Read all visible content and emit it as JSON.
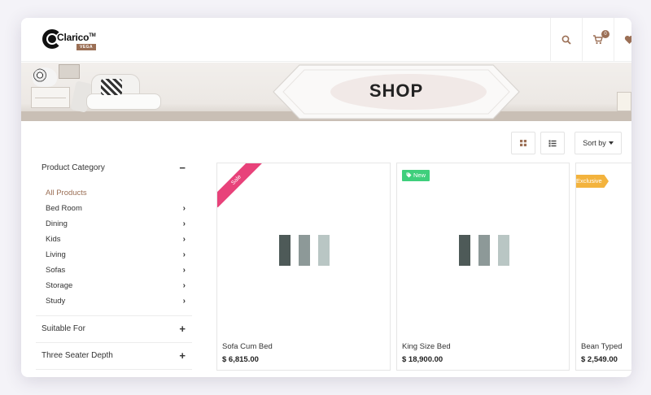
{
  "brand": {
    "name": "Clarico",
    "tm": "TM",
    "tag": "VEGA"
  },
  "header": {
    "icons": [
      "search-icon",
      "cart-icon",
      "heart-icon"
    ],
    "cart_count": "0"
  },
  "banner": {
    "title": "SHOP"
  },
  "toolbar": {
    "sort_label": "Sort by"
  },
  "sidebar": {
    "category_title": "Product Category",
    "categories": [
      "All Products",
      "Bed Room",
      "Dining",
      "Kids",
      "Living",
      "Sofas",
      "Storage",
      "Study"
    ],
    "filters": [
      "Suitable For",
      "Three Seater Depth"
    ]
  },
  "products": [
    {
      "name": "Sofa Cum Bed",
      "price": "$ 6,815.00",
      "badge": "Sale"
    },
    {
      "name": "King Size Bed",
      "price": "$ 18,900.00",
      "badge": "New"
    },
    {
      "name": "Bean Typed",
      "price": "$ 2,549.00",
      "badge": "Exclusive"
    }
  ],
  "colors": {
    "accent": "#9b6f55",
    "sale": "#e8427a",
    "new": "#3fcf7c",
    "exclusive": "#f3b33d"
  }
}
